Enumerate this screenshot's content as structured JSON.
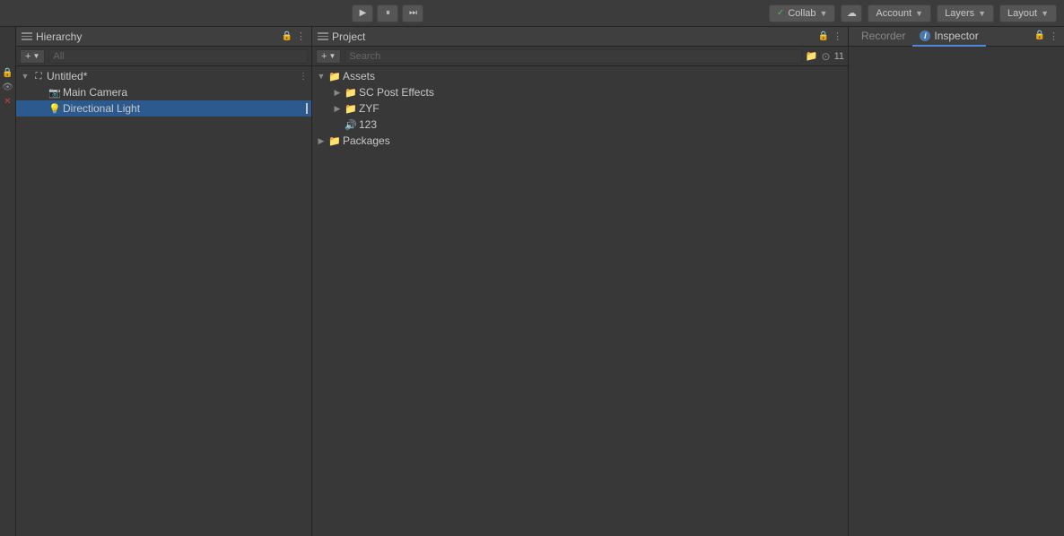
{
  "topbar": {
    "play_label": "▶",
    "pause_label": "⏸",
    "step_label": "⏭",
    "collab_label": "Collab",
    "account_label": "Account",
    "layers_label": "Layers",
    "layout_label": "Layout"
  },
  "hierarchy": {
    "title": "Hierarchy",
    "search_placeholder": "All",
    "scene": {
      "name": "Untitled*",
      "children": [
        {
          "label": "Main Camera",
          "icon": "📷"
        },
        {
          "label": "Directional Light",
          "icon": "💡"
        }
      ]
    }
  },
  "project": {
    "title": "Project",
    "search_placeholder": "Search",
    "count_label": "11",
    "tree": [
      {
        "label": "Assets",
        "type": "folder",
        "expanded": true,
        "indent": 0,
        "children": [
          {
            "label": "SC Post Effects",
            "type": "folder",
            "indent": 1
          },
          {
            "label": "ZYF",
            "type": "folder",
            "indent": 1
          },
          {
            "label": "123",
            "type": "audio",
            "indent": 1
          }
        ]
      },
      {
        "label": "Packages",
        "type": "folder",
        "expanded": false,
        "indent": 0
      }
    ]
  },
  "recorder": {
    "label": "Recorder"
  },
  "inspector": {
    "label": "Inspector"
  }
}
